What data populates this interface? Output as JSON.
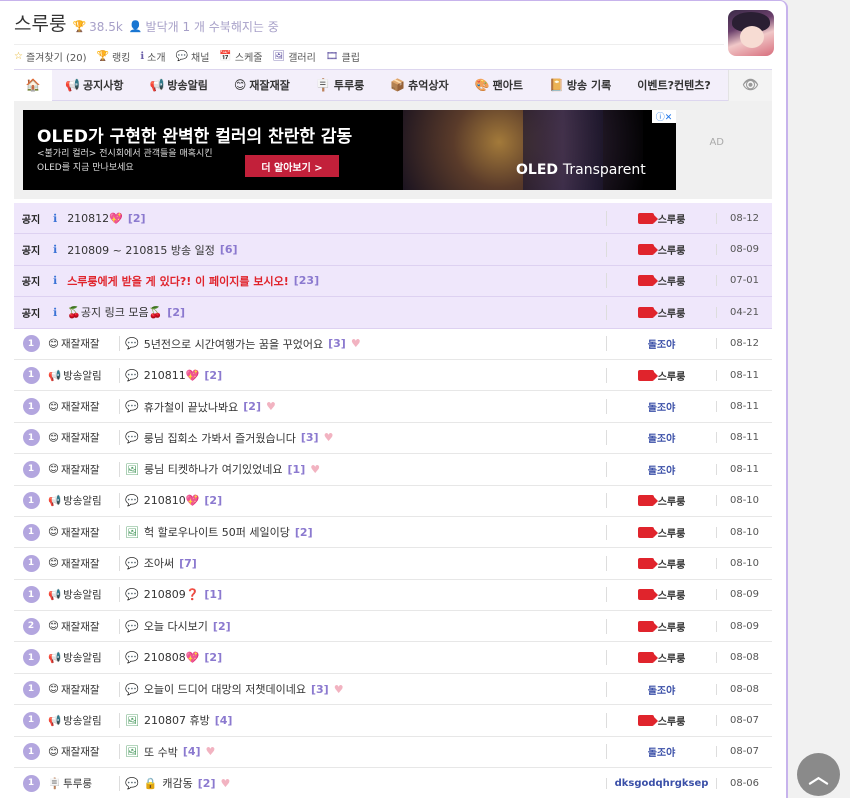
{
  "channel": {
    "title": "스루룽",
    "trophy_icon": "trophy-icon",
    "score": "38.5k",
    "status": "발닥개 1 개 수북해지는 중"
  },
  "links": [
    {
      "icon": "star-icon",
      "label": "즐겨찾기 (20)"
    },
    {
      "icon": "trophy-icon",
      "label": "랭킹"
    },
    {
      "icon": "info-icon",
      "label": "소개"
    },
    {
      "icon": "chat-icon",
      "label": "채널"
    },
    {
      "icon": "calendar-icon",
      "label": "스케줄"
    },
    {
      "icon": "image-icon",
      "label": "갤러리"
    },
    {
      "icon": "film-icon",
      "label": "클립"
    }
  ],
  "nav": [
    {
      "icon": "megaphone-icon",
      "label": "공지사항"
    },
    {
      "icon": "loudspeaker-icon",
      "label": "방송알림"
    },
    {
      "icon": "face-icon",
      "label": "재잘재잘"
    },
    {
      "icon": "sign-icon",
      "label": "투루룽"
    },
    {
      "icon": "box-icon",
      "label": "츄억상자"
    },
    {
      "icon": "palette-icon",
      "label": "팬아트"
    },
    {
      "icon": "book-icon",
      "label": "방송 기록"
    },
    {
      "icon": "",
      "label": "이벤트?컨텐츠?"
    }
  ],
  "ad": {
    "headline": "OLED가 구현한 완벽한 컬러의 찬란한 감동",
    "line1": "<불가리 컬러> 전시회에서 관객들을 매혹시킨",
    "line2": "OLED를 지금 만나보세요",
    "button": "더 알아보기  >",
    "brand": "OLED",
    "brand2": "Transparent",
    "label": "AD",
    "close": "ⓘ✕"
  },
  "notices": [
    {
      "tag": "공지",
      "title": "210812💖",
      "comments": "[2]",
      "author": "스루룽",
      "date": "08-12",
      "red": false
    },
    {
      "tag": "공지",
      "title": "210809 ~ 210815 방송 일정",
      "comments": "[6]",
      "author": "스루룽",
      "date": "08-09",
      "red": false
    },
    {
      "tag": "공지",
      "title": "스루룽에게 받을 게 있다?! 이 페이지를 보시오!",
      "comments": "[23]",
      "author": "스루룽",
      "date": "07-01",
      "red": true
    },
    {
      "tag": "공지",
      "title": "🍒공지 링크 모음🍒",
      "comments": "[2]",
      "author": "스루룽",
      "date": "04-21",
      "red": false
    }
  ],
  "posts": [
    {
      "n": "1",
      "cat": "재잘재잘",
      "cat_icon": "face-icon",
      "type": "chat",
      "title": "5년전으로 시간여행가는 꿈을 꾸었어요",
      "comments": "[3]",
      "heart": true,
      "author": "돌조야",
      "streamer": false,
      "date": "08-12"
    },
    {
      "n": "1",
      "cat": "방송알림",
      "cat_icon": "loudspeaker-icon",
      "type": "chat",
      "title": "210811💖",
      "comments": "[2]",
      "heart": false,
      "author": "스루룽",
      "streamer": true,
      "date": "08-11"
    },
    {
      "n": "1",
      "cat": "재잘재잘",
      "cat_icon": "face-icon",
      "type": "chat",
      "title": "휴가철이 끝났나봐요",
      "comments": "[2]",
      "heart": true,
      "author": "돌조야",
      "streamer": false,
      "date": "08-11"
    },
    {
      "n": "1",
      "cat": "재잘재잘",
      "cat_icon": "face-icon",
      "type": "chat",
      "title": "룽님 집회소 가봐서 즐거웠습니다",
      "comments": "[3]",
      "heart": true,
      "author": "돌조야",
      "streamer": false,
      "date": "08-11"
    },
    {
      "n": "1",
      "cat": "재잘재잘",
      "cat_icon": "face-icon",
      "type": "image",
      "title": "룽님 티켓하나가 여기있었네요",
      "comments": "[1]",
      "heart": true,
      "author": "돌조야",
      "streamer": false,
      "date": "08-11"
    },
    {
      "n": "1",
      "cat": "방송알림",
      "cat_icon": "loudspeaker-icon",
      "type": "chat",
      "title": "210810💖",
      "comments": "[2]",
      "heart": false,
      "author": "스루룽",
      "streamer": true,
      "date": "08-10"
    },
    {
      "n": "1",
      "cat": "재잘재잘",
      "cat_icon": "face-icon",
      "type": "image",
      "title": "헉 할로우나이트 50퍼 세일이당",
      "comments": "[2]",
      "heart": false,
      "author": "스루룽",
      "streamer": true,
      "date": "08-10"
    },
    {
      "n": "1",
      "cat": "재잘재잘",
      "cat_icon": "face-icon",
      "type": "chat",
      "title": "조아써",
      "comments": "[7]",
      "heart": false,
      "author": "스루룽",
      "streamer": true,
      "date": "08-10"
    },
    {
      "n": "1",
      "cat": "방송알림",
      "cat_icon": "loudspeaker-icon",
      "type": "chat",
      "title": "210809❓",
      "comments": "[1]",
      "heart": false,
      "author": "스루룽",
      "streamer": true,
      "date": "08-09"
    },
    {
      "n": "2",
      "cat": "재잘재잘",
      "cat_icon": "face-icon",
      "type": "chat",
      "title": "오늘 다시보기",
      "comments": "[2]",
      "heart": false,
      "author": "스루룽",
      "streamer": true,
      "date": "08-09"
    },
    {
      "n": "1",
      "cat": "방송알림",
      "cat_icon": "loudspeaker-icon",
      "type": "chat",
      "title": "210808💖",
      "comments": "[2]",
      "heart": false,
      "author": "스루룽",
      "streamer": true,
      "date": "08-08"
    },
    {
      "n": "1",
      "cat": "재잘재잘",
      "cat_icon": "face-icon",
      "type": "chat",
      "title": "오늘이 드디어 대망의 저챗데이네요",
      "comments": "[3]",
      "heart": true,
      "author": "돌조야",
      "streamer": false,
      "date": "08-08"
    },
    {
      "n": "1",
      "cat": "방송알림",
      "cat_icon": "loudspeaker-icon",
      "type": "image",
      "title": "210807 휴방",
      "comments": "[4]",
      "heart": false,
      "author": "스루룽",
      "streamer": true,
      "date": "08-07"
    },
    {
      "n": "1",
      "cat": "재잘재잘",
      "cat_icon": "face-icon",
      "type": "image",
      "title": "또 수박",
      "comments": "[4]",
      "heart": true,
      "author": "돌조야",
      "streamer": false,
      "date": "08-07"
    },
    {
      "n": "1",
      "cat": "투루룽",
      "cat_icon": "sign-icon",
      "type": "chat-lock",
      "title": "캐감동",
      "comments": "[2]",
      "heart": true,
      "author": "dksgodqhrgksep",
      "streamer": false,
      "date": "08-06"
    }
  ],
  "colors": {
    "accent": "#b3a6df",
    "notice_bg": "#efe7fb",
    "comment": "#8b79cf",
    "author_link": "#3b50a8",
    "streamer_red": "#e0242c"
  }
}
